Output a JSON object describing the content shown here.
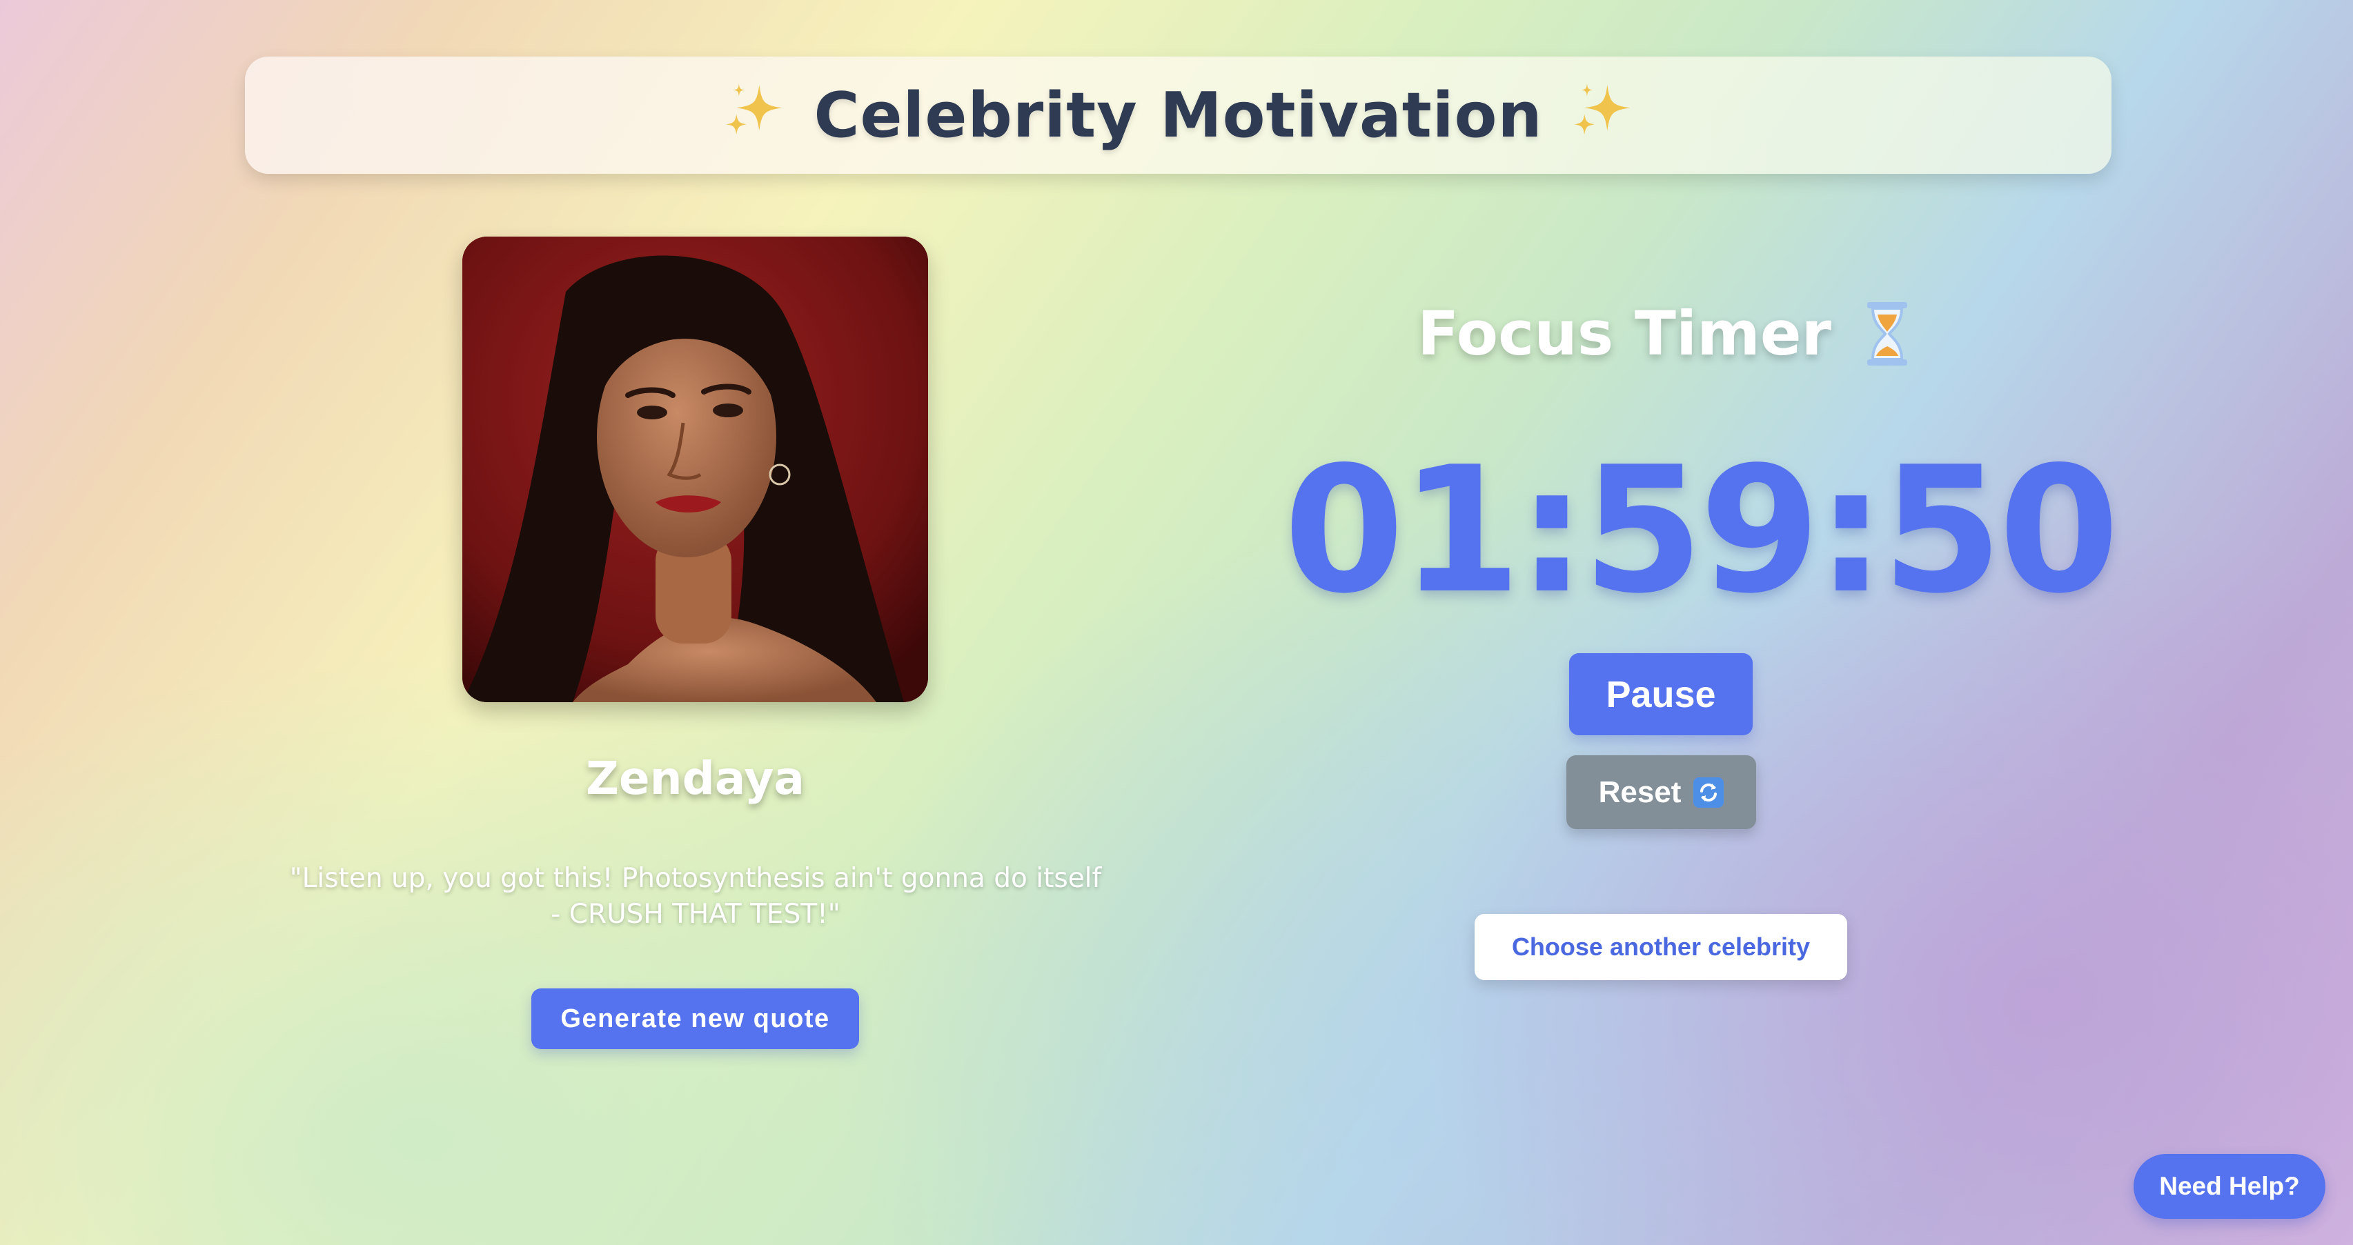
{
  "header": {
    "title": "Celebrity Motivation",
    "left_icon": "sparkles-icon",
    "right_icon": "sparkles-icon"
  },
  "celebrity": {
    "name": "Zendaya",
    "quote": "\"Listen up, you got this! Photosynthesis ain't gonna do itself - CRUSH THAT TEST!\"",
    "generate_button_label": "Generate new quote"
  },
  "timer": {
    "title": "Focus Timer",
    "title_icon": "hourglass-icon",
    "time": "01:59:50",
    "pause_label": "Pause",
    "reset_label": "Reset",
    "reset_icon": "refresh-icon"
  },
  "choose_button_label": "Choose another celebrity",
  "help_button_label": "Need Help?",
  "colors": {
    "accent": "#5572ef",
    "title_text": "#2f3b52",
    "reset_button": "#838f98",
    "sparkle": "#f0c44c"
  }
}
